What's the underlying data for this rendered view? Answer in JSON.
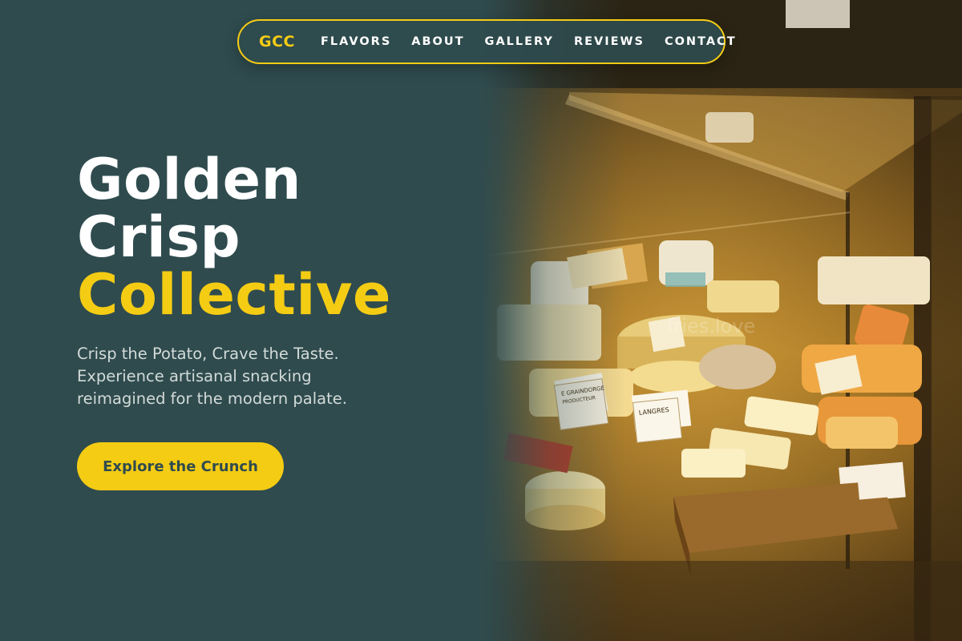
{
  "nav": {
    "brand": "GCC",
    "links": [
      "FLAVORS",
      "ABOUT",
      "GALLERY",
      "REVIEWS",
      "CONTACT"
    ]
  },
  "hero": {
    "title_lines": [
      "Golden",
      "Crisp",
      "Collective"
    ],
    "subtitle_lines": [
      "Crisp the Potato, Crave the Taste.",
      "Experience artisanal snacking",
      "reimagined for the modern palate."
    ],
    "cta_label": "Explore the Crunch",
    "image_watermark": "fries.love",
    "image_tags": [
      "LANGRES",
      "E GRAINDORGE PRODUCTEUR"
    ]
  },
  "colors": {
    "background": "#2f4b4e",
    "accent": "#f5cc14",
    "text": "#ffffff",
    "muted_text": "#d3dbd9"
  }
}
